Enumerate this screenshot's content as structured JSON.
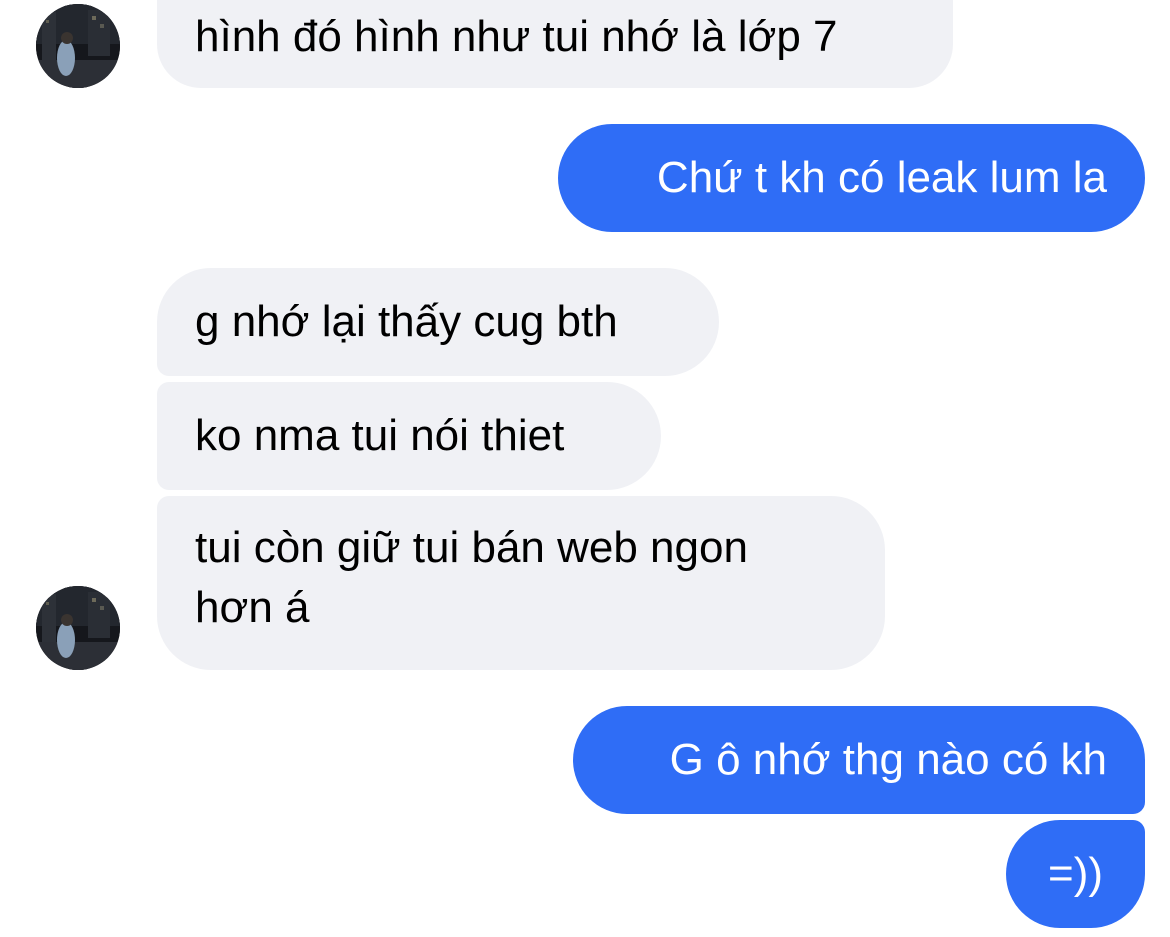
{
  "colors": {
    "incoming_bubble": "#f0f1f5",
    "outgoing_bubble": "#2f6df6",
    "incoming_text": "#000000",
    "outgoing_text": "#ffffff",
    "background": "#ffffff"
  },
  "contact": {
    "avatar_icon": "profile-photo-icon"
  },
  "messages": [
    {
      "direction": "incoming",
      "text": "hình đó hình như tui nhớ là lớp 7"
    },
    {
      "direction": "outgoing",
      "text": "Chứ t kh có leak lum la"
    },
    {
      "direction": "incoming",
      "text": "g nhớ lại thấy cug bth"
    },
    {
      "direction": "incoming",
      "text": "ko nma tui nói thiet"
    },
    {
      "direction": "incoming",
      "lines": [
        "tui còn giữ tui bán web ngon",
        "hơn á"
      ]
    },
    {
      "direction": "outgoing",
      "text": "G ô nhớ thg nào có kh"
    },
    {
      "direction": "outgoing",
      "text": "=))"
    }
  ]
}
